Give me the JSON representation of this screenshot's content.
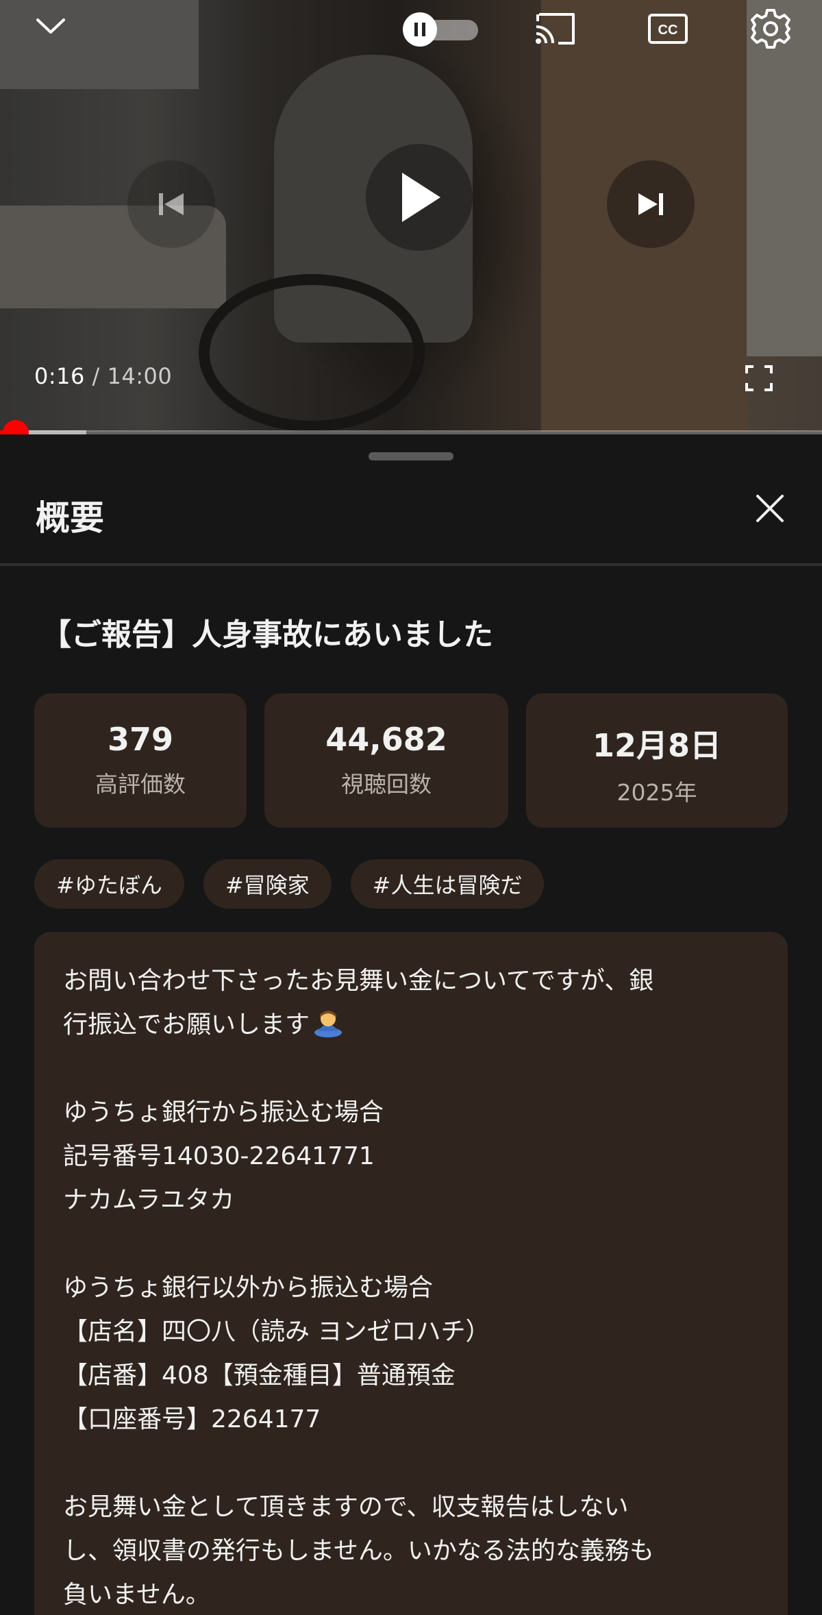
{
  "player": {
    "current_time": "0:16",
    "separator": " / ",
    "duration": "14:00",
    "progress_fraction": 0.019,
    "buffered_fraction": 0.105,
    "accent_color": "#ff0000",
    "icons": {
      "minimize": "chevron-down-icon",
      "autoplay": "autoplay-toggle-icon",
      "cast": "cast-icon",
      "captions": "closed-captions-icon",
      "settings": "gear-icon",
      "previous": "previous-icon",
      "play": "play-icon",
      "next": "next-icon",
      "fullscreen": "fullscreen-icon"
    }
  },
  "sheet": {
    "title": "概要",
    "close_icon": "close-icon",
    "video_title": "【ご報告】人身事故にあいました",
    "stats": [
      {
        "value": "379",
        "label": "高評価数"
      },
      {
        "value": "44,682",
        "label": "視聴回数"
      },
      {
        "value": "12月8日",
        "label": "2025年"
      }
    ],
    "tags": [
      "#ゆたぼん",
      "#冒険家",
      "#人生は冒険だ"
    ],
    "description": {
      "line_1": "お問い合わせ下さったお見舞い金についてですが、銀",
      "line_2": "行振込でお願いします",
      "line_2_emoji": "person-bowing-emoji",
      "line_3": "ゆうちょ銀行から振込む場合",
      "line_4": "記号番号14030-22641771",
      "line_5": "ナカムラユタカ",
      "line_6": "ゆうちょ銀行以外から振込む場合",
      "line_7": "【店名】四〇八（読み ヨンゼロハチ）",
      "line_8": "【店番】408【預金種目】普通預金",
      "line_9": "【口座番号】2264177",
      "line_10": "お見舞い金として頂きますので、収支報告はしない",
      "line_11": "し、領収書の発行もしません。いかなる法的な義務も",
      "line_12": "負いません。"
    }
  },
  "colors": {
    "sheet_bg": "#161616",
    "card_bg": "#2f251e",
    "text": "#f1f1f1",
    "muted_text": "#b9b2ab"
  }
}
